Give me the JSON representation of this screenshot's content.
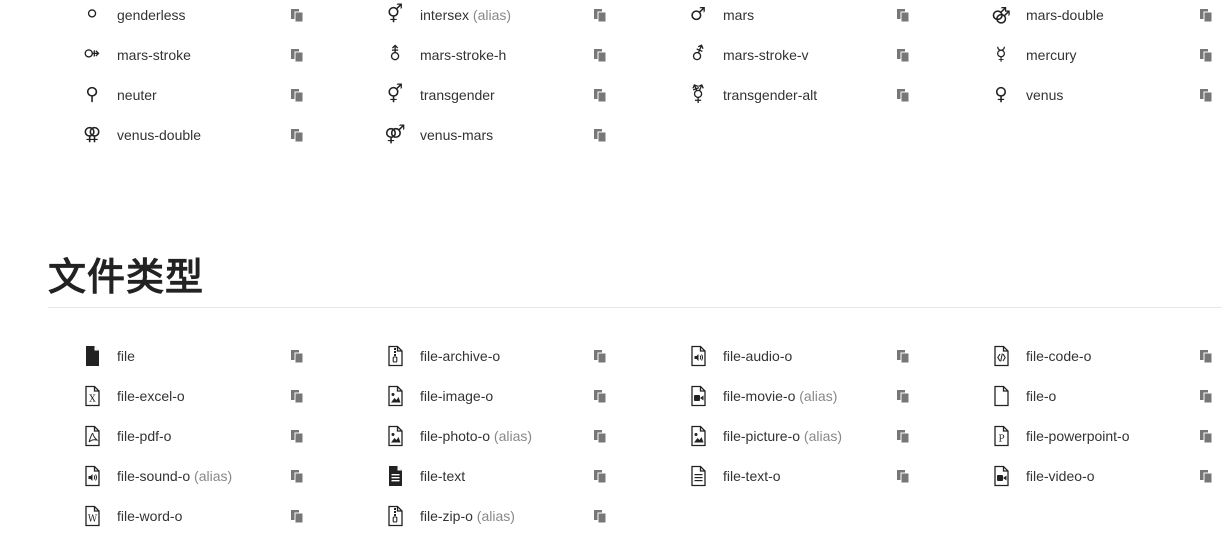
{
  "gender_icons": [
    {
      "name": "genderless",
      "alias": "",
      "icon": "genderless-icon",
      "glyph": "⚪"
    },
    {
      "name": "intersex",
      "alias": "(alias)",
      "icon": "intersex-icon",
      "glyph": "⚥"
    },
    {
      "name": "mars",
      "alias": "",
      "icon": "mars-icon",
      "glyph": "♂"
    },
    {
      "name": "mars-double",
      "alias": "",
      "icon": "mars-double-icon",
      "glyph": "⚣"
    },
    {
      "name": "mars-stroke",
      "alias": "",
      "icon": "mars-stroke-icon",
      "glyph": "⚩"
    },
    {
      "name": "mars-stroke-h",
      "alias": "",
      "icon": "mars-stroke-h-icon",
      "glyph": "⚨"
    },
    {
      "name": "mars-stroke-v",
      "alias": "",
      "icon": "mars-stroke-v-icon",
      "glyph": "⚦"
    },
    {
      "name": "mercury",
      "alias": "",
      "icon": "mercury-icon",
      "glyph": "☿"
    },
    {
      "name": "neuter",
      "alias": "",
      "icon": "neuter-icon",
      "glyph": "⚲"
    },
    {
      "name": "transgender",
      "alias": "",
      "icon": "transgender-icon",
      "glyph": "⚥"
    },
    {
      "name": "transgender-alt",
      "alias": "",
      "icon": "transgender-alt-icon",
      "glyph": "⚧"
    },
    {
      "name": "venus",
      "alias": "",
      "icon": "venus-icon",
      "glyph": "♀"
    },
    {
      "name": "venus-double",
      "alias": "",
      "icon": "venus-double-icon",
      "glyph": "⚢"
    },
    {
      "name": "venus-mars",
      "alias": "",
      "icon": "venus-mars-icon",
      "glyph": "⚤"
    }
  ],
  "file_section": {
    "title": "文件类型",
    "icons": [
      {
        "name": "file",
        "alias": "",
        "icon": "file-icon",
        "kind": "solid"
      },
      {
        "name": "file-archive-o",
        "alias": "",
        "icon": "file-archive-o-icon",
        "kind": "archive"
      },
      {
        "name": "file-audio-o",
        "alias": "",
        "icon": "file-audio-o-icon",
        "kind": "audio"
      },
      {
        "name": "file-code-o",
        "alias": "",
        "icon": "file-code-o-icon",
        "kind": "code"
      },
      {
        "name": "file-excel-o",
        "alias": "",
        "icon": "file-excel-o-icon",
        "kind": "excel"
      },
      {
        "name": "file-image-o",
        "alias": "",
        "icon": "file-image-o-icon",
        "kind": "image"
      },
      {
        "name": "file-movie-o",
        "alias": "(alias)",
        "icon": "file-movie-o-icon",
        "kind": "video"
      },
      {
        "name": "file-o",
        "alias": "",
        "icon": "file-o-icon",
        "kind": "outline"
      },
      {
        "name": "file-pdf-o",
        "alias": "",
        "icon": "file-pdf-o-icon",
        "kind": "pdf"
      },
      {
        "name": "file-photo-o",
        "alias": "(alias)",
        "icon": "file-photo-o-icon",
        "kind": "image"
      },
      {
        "name": "file-picture-o",
        "alias": "(alias)",
        "icon": "file-picture-o-icon",
        "kind": "image"
      },
      {
        "name": "file-powerpoint-o",
        "alias": "",
        "icon": "file-powerpoint-o-icon",
        "kind": "powerpoint"
      },
      {
        "name": "file-sound-o",
        "alias": "(alias)",
        "icon": "file-sound-o-icon",
        "kind": "audio"
      },
      {
        "name": "file-text",
        "alias": "",
        "icon": "file-text-icon",
        "kind": "solid-text"
      },
      {
        "name": "file-text-o",
        "alias": "",
        "icon": "file-text-o-icon",
        "kind": "text"
      },
      {
        "name": "file-video-o",
        "alias": "",
        "icon": "file-video-o-icon",
        "kind": "video"
      },
      {
        "name": "file-word-o",
        "alias": "",
        "icon": "file-word-o-icon",
        "kind": "word"
      },
      {
        "name": "file-zip-o",
        "alias": "(alias)",
        "icon": "file-zip-o-icon",
        "kind": "archive"
      }
    ]
  },
  "copy_icon": "copy-icon",
  "colors": {
    "text": "#333333",
    "alias": "#888888",
    "icon": "#222222",
    "copy": "#777777",
    "divider": "#e6e6e6"
  }
}
